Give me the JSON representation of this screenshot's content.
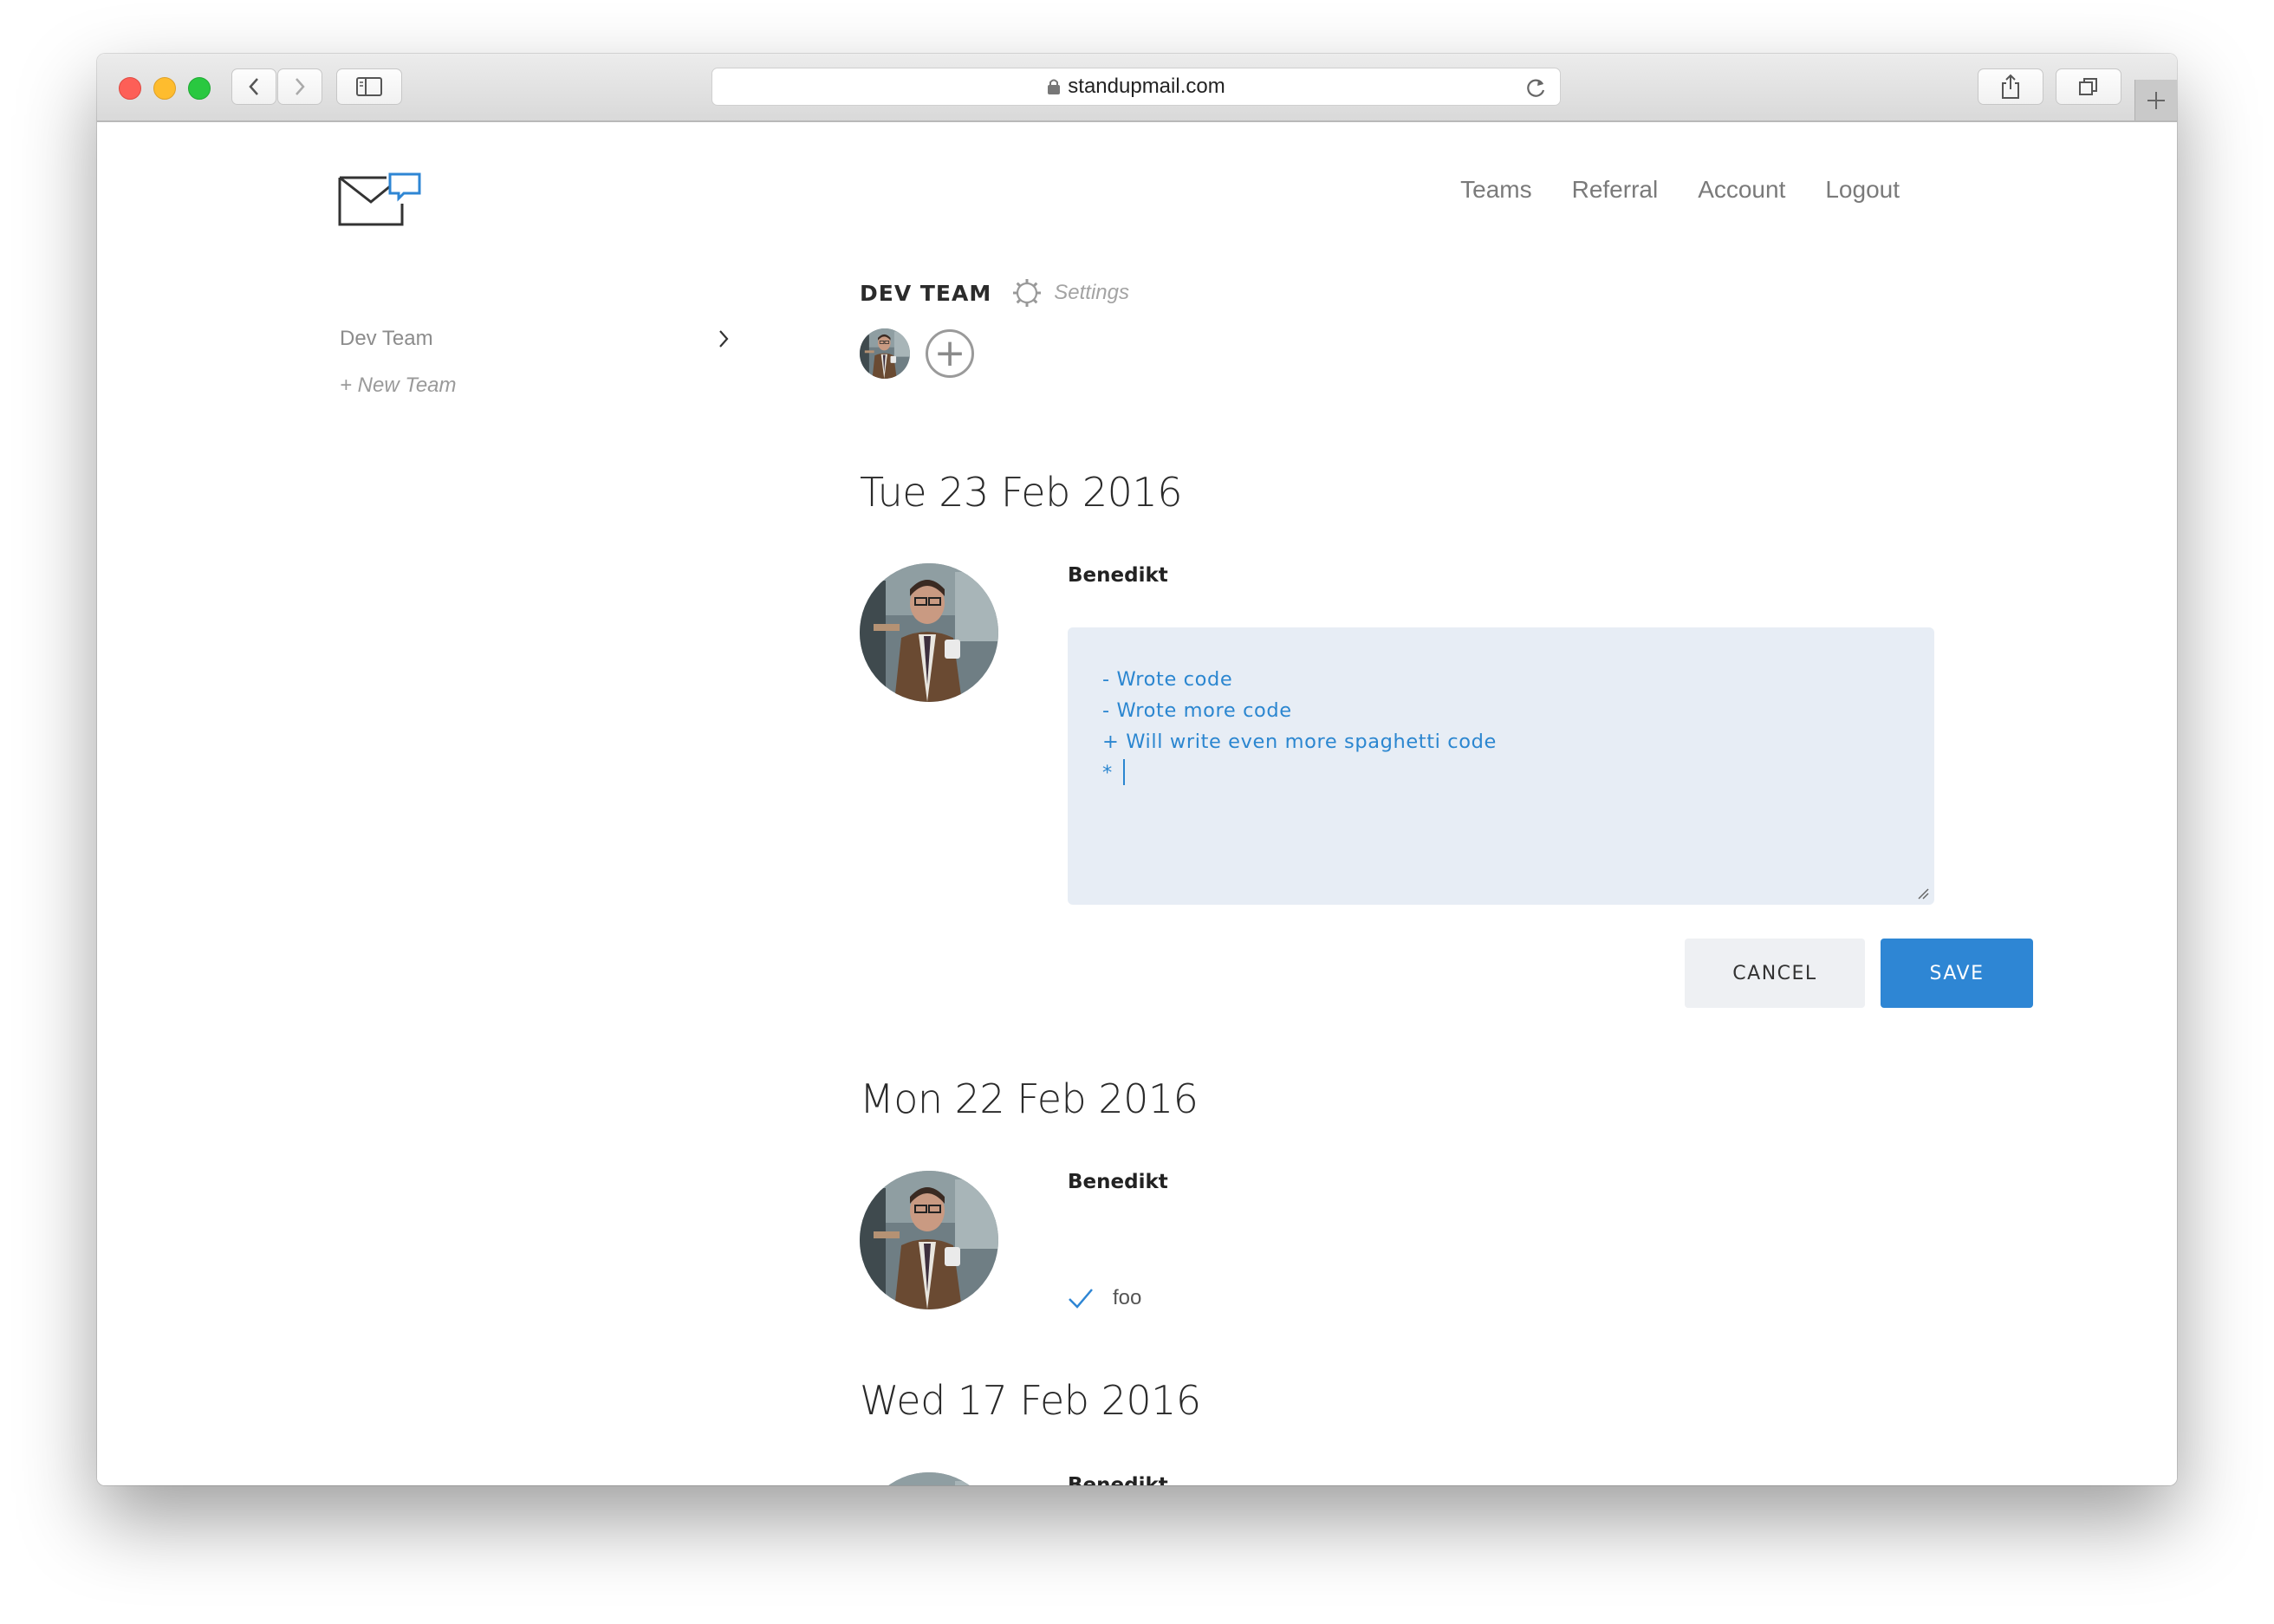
{
  "browser": {
    "url": "standupmail.com"
  },
  "nav": {
    "items": [
      "Teams",
      "Referral",
      "Account",
      "Logout"
    ]
  },
  "sidebar": {
    "teams": [
      {
        "label": "Dev Team"
      }
    ],
    "new_team_label": "+ New Team"
  },
  "team": {
    "name": "DEV TEAM",
    "settings_label": "Settings",
    "add_member_symbol": "+"
  },
  "days": [
    {
      "date": "Tue 23 Feb 2016",
      "author": "Benedikt",
      "editor_lines": [
        "- Wrote code",
        "- Wrote more code",
        "+ Will write even more spaghetti code",
        "* "
      ],
      "cancel_label": "CANCEL",
      "save_label": "SAVE"
    },
    {
      "date": "Mon 22 Feb 2016",
      "author": "Benedikt",
      "tasks": [
        {
          "text": "foo",
          "done": true
        }
      ]
    },
    {
      "date": "Wed 17 Feb 2016",
      "author": "Benedikt"
    }
  ],
  "colors": {
    "accent": "#2e86d4",
    "editor_bg": "#e7edf5",
    "editor_text": "#2b86d0"
  }
}
